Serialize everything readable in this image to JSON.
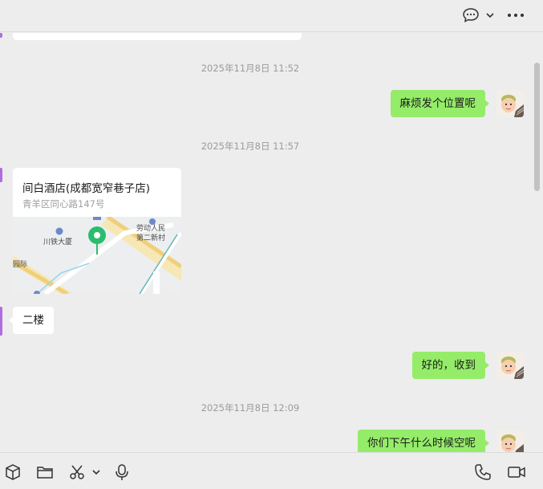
{
  "header": {
    "icons": [
      "chat-bubble-icon",
      "chevron-down-icon",
      "more-icon"
    ]
  },
  "messages": {
    "ts1": "2025年11月8日 11:52",
    "msg1": "麻烦发个位置呢",
    "ts2": "2025年11月8日 11:57",
    "location": {
      "title": "间白酒店(成都宽窄巷子店)",
      "address": "青羊区同心路147号",
      "map_labels": {
        "building": "川铁大厦",
        "labor1": "劳动人民",
        "labor2": "第二新村",
        "edge": "园际"
      }
    },
    "msg2": "二楼",
    "msg3": "好的，收到",
    "ts3": "2025年11月8日 12:09",
    "msg4": "你们下午什么时候空呢"
  },
  "toolbar": {
    "icons": [
      "package-icon",
      "folder-icon",
      "scissors-icon",
      "chevron-down-icon",
      "microphone-icon",
      "phone-icon",
      "video-icon"
    ]
  },
  "colors": {
    "my_bubble": "#95ec69",
    "their_bubble": "#ffffff",
    "background": "#ededed",
    "accent_pin": "#2bbd6e"
  }
}
